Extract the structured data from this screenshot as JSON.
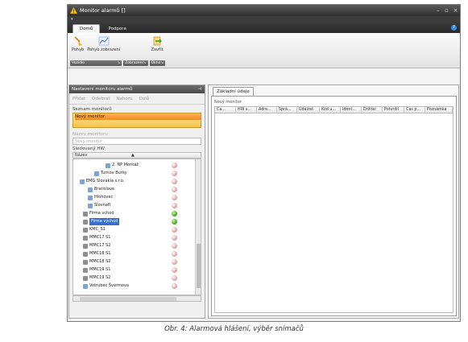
{
  "window": {
    "title": "Monitor alarmů []"
  },
  "ribbon": {
    "tabs": [
      "Domů",
      "Podpora"
    ],
    "buttons": {
      "pohyb": "Pohyb",
      "zobrazeni": "Pohyb zobrazení",
      "zavrit": "Zavřít"
    },
    "groups": {
      "vozidlo": "Vozidlo",
      "zobrazeni": "Zobrazení",
      "okno": "Okno"
    }
  },
  "left_panel": {
    "header": "Nastavení monitoru alarmů",
    "toolbar": [
      "Přidat",
      "Odebrat",
      "Nahoru",
      "Dolů"
    ],
    "monitor_list_label": "Seznam monitorů",
    "monitor_selected": "Nový monitor",
    "name_label": "Název monitoru",
    "name_value": "Nový monitor",
    "hw_label": "Sledovaný HW",
    "tree_header": "Název",
    "tree_items": [
      {
        "label": "2. NP Montáž",
        "status": "off"
      },
      {
        "label": "Turnov Burky",
        "status": "off"
      },
      {
        "label": "EMG Slovakia s.r.o.",
        "status": "off"
      },
      {
        "label": "Bratislava",
        "status": "off"
      },
      {
        "label": "Hlohovec",
        "status": "off"
      },
      {
        "label": "Slovnaft",
        "status": "off"
      },
      {
        "label": "Firma vchod",
        "status": "ok"
      },
      {
        "label": "Firma východ",
        "status": "ok"
      },
      {
        "label": "KMC_S1",
        "status": "off"
      },
      {
        "label": "MMC17 S1",
        "status": "off"
      },
      {
        "label": "MMC17 S2",
        "status": "off"
      },
      {
        "label": "MMC18 S1",
        "status": "off"
      },
      {
        "label": "MMC18 S2",
        "status": "off"
      },
      {
        "label": "MMC19 S1",
        "status": "off"
      },
      {
        "label": "MMC19 S2",
        "status": "off"
      },
      {
        "label": "Votrubec Švermova",
        "status": "off"
      }
    ]
  },
  "right_panel": {
    "tab": "Základní údaje",
    "label": "Nový monitor",
    "columns": [
      "Ča...",
      "HW s...",
      "Adre...",
      "Sprá...",
      "Událost",
      "Kód u...",
      "Ident...",
      "Držitel",
      "Potvrdil",
      "Čas p...",
      "Poznámka"
    ]
  },
  "caption": "Obr. 4: Alarmová hlášení, výběr snímačů"
}
